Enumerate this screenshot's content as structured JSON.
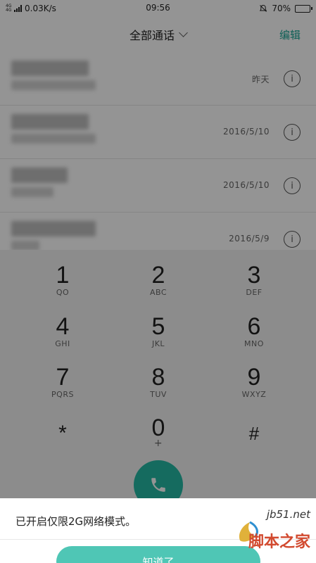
{
  "status_bar": {
    "network_mini": "4G 4G",
    "speed": "0.03K/s",
    "time": "09:56",
    "battery": "70%",
    "battery_level": 0.7
  },
  "header": {
    "title": "全部通话",
    "edit_label": "编辑"
  },
  "calls": [
    {
      "date": "昨天"
    },
    {
      "date": "2016/5/10"
    },
    {
      "date": "2016/5/10"
    },
    {
      "date": "2016/5/9"
    }
  ],
  "dialpad": {
    "keys": [
      {
        "digit": "1",
        "letters": "QO"
      },
      {
        "digit": "2",
        "letters": "ABC"
      },
      {
        "digit": "3",
        "letters": "DEF"
      },
      {
        "digit": "4",
        "letters": "GHI"
      },
      {
        "digit": "5",
        "letters": "JKL"
      },
      {
        "digit": "6",
        "letters": "MNO"
      },
      {
        "digit": "7",
        "letters": "PQRS"
      },
      {
        "digit": "8",
        "letters": "TUV"
      },
      {
        "digit": "9",
        "letters": "WXYZ"
      },
      {
        "digit": "*",
        "letters": ""
      },
      {
        "digit": "0",
        "letters": "+"
      },
      {
        "digit": "#",
        "letters": ""
      }
    ]
  },
  "sheet": {
    "message": "已开启仅限2G网络模式。",
    "button_label": "知道了"
  },
  "watermark": {
    "domain": "jb51.net",
    "text": "脚本之家"
  },
  "colors": {
    "accent": "#1aa596",
    "call_button": "#25b8a4"
  }
}
